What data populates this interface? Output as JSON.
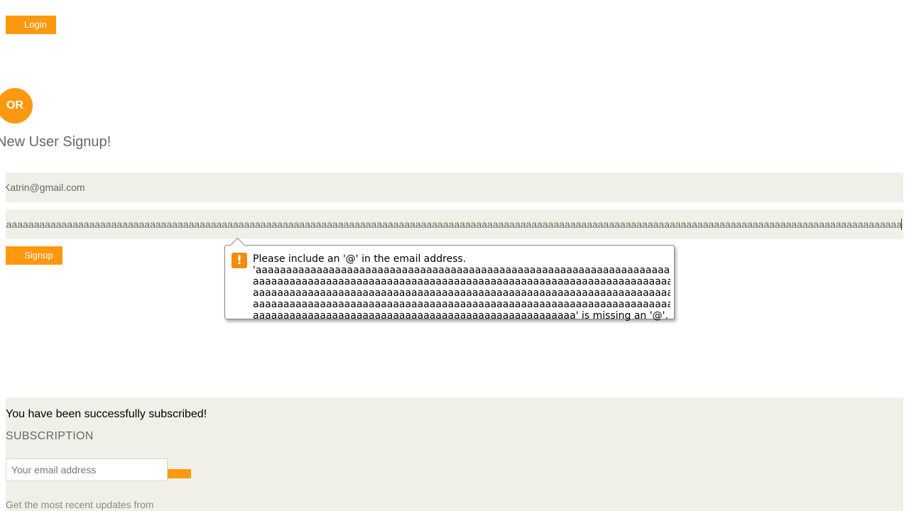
{
  "login": {
    "button_label": "Login"
  },
  "or_label": "OR",
  "signup": {
    "title": "New User Signup!",
    "name_value": "Katrin@gmail.com",
    "email_value": "aaaaaaaaaaaaaaaaaaaaaaaaaaaaaaaaaaaaaaaaaaaaaaaaaaaaaaaaaaaaaaaaaaaaaaaaaaaaaaaaaaaaaaaaaaaaaaaaaaaaaaaaaaaaaaaaaaaaaaaaaaaaaaaaaaaaaaaaaaaaaaaaaaaaaaaaaaaaaaaaaaaaaaaaaaaaaaaaaaaaaaaaaaaaaaaaaaa",
    "button_label": "Signup"
  },
  "validation_tooltip": {
    "text": "Please include an '@' in the email address.\n'aaaaaaaaaaaaaaaaaaaaaaaaaaaaaaaaaaaaaaaaaaaaaaaaaaaaaaaaaaaaaaaaaaaaaaaa\naaaaaaaaaaaaaaaaaaaaaaaaaaaaaaaaaaaaaaaaaaaaaaaaaaaaaaaaaaaaaaaaaaaaaaaaa\naaaaaaaaaaaaaaaaaaaaaaaaaaaaaaaaaaaaaaaaaaaaaaaaaaaaaaaaaaaaaaaaaaaaaaaaa\naaaaaaaaaaaaaaaaaaaaaaaaaaaaaaaaaaaaaaaaaaaaaaaaaaaaaaaaaaaaaaaaaaaaaaaaa\naaaaaaaaaaaaaaaaaaaaaaaaaaaaaaaaaaaaaaaaaaaaaaaaaaaaa' is missing an '@'.",
    "icon": "warning-icon"
  },
  "subscription": {
    "success_message": "You have been successfully subscribed!",
    "title": "SUBSCRIPTION",
    "email_placeholder": "Your email address",
    "description": "Get the most recent updates from"
  },
  "colors": {
    "accent": "#fe980f",
    "field_bg": "#f0f0e9",
    "text_muted": "#696763"
  }
}
